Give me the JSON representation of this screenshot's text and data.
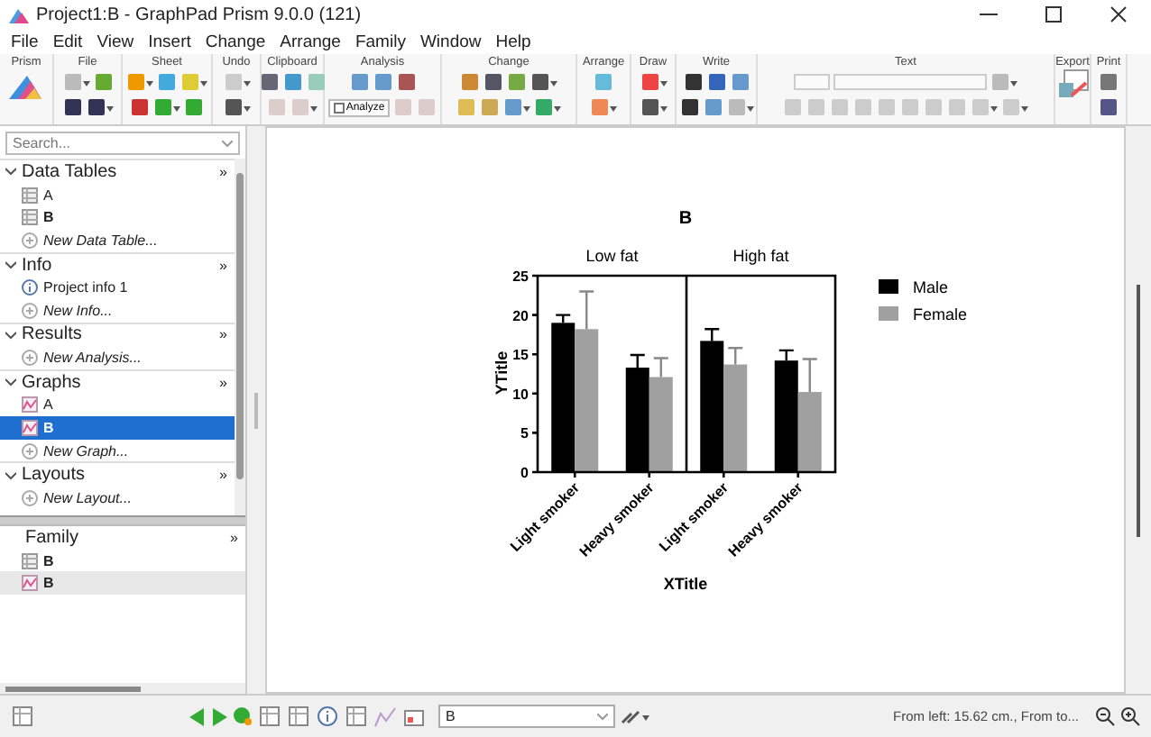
{
  "window": {
    "title": "Project1:B - GraphPad Prism 9.0.0 (121)"
  },
  "menu": [
    "File",
    "Edit",
    "View",
    "Insert",
    "Change",
    "Arrange",
    "Family",
    "Window",
    "Help"
  ],
  "toolbar": {
    "groups": [
      "Prism",
      "File",
      "Sheet",
      "Undo",
      "Clipboard",
      "Analysis",
      "Change",
      "Arrange",
      "Draw",
      "Write",
      "Text",
      "Export",
      "Print"
    ],
    "analyze_button": "Analyze"
  },
  "sidebar": {
    "search": {
      "placeholder": "Search..."
    },
    "sections": [
      {
        "title": "Data Tables",
        "more": "»",
        "expanded": true,
        "items": [
          {
            "kind": "table",
            "label": "A",
            "bold": false,
            "selected": false
          },
          {
            "kind": "table",
            "label": "B",
            "bold": true,
            "selected": false
          },
          {
            "kind": "new",
            "label": "New Data Table...",
            "bold": false,
            "selected": false
          }
        ]
      },
      {
        "title": "Info",
        "more": "»",
        "expanded": true,
        "items": [
          {
            "kind": "info",
            "label": "Project info 1",
            "bold": false,
            "selected": false
          },
          {
            "kind": "new",
            "label": "New Info...",
            "bold": false,
            "selected": false
          }
        ]
      },
      {
        "title": "Results",
        "more": "»",
        "expanded": true,
        "items": [
          {
            "kind": "new",
            "label": "New Analysis...",
            "bold": false,
            "selected": false
          }
        ]
      },
      {
        "title": "Graphs",
        "more": "»",
        "expanded": true,
        "items": [
          {
            "kind": "graph",
            "label": "A",
            "bold": false,
            "selected": false
          },
          {
            "kind": "graph",
            "label": "B",
            "bold": true,
            "selected": true
          },
          {
            "kind": "new",
            "label": "New Graph...",
            "bold": false,
            "selected": false
          }
        ]
      },
      {
        "title": "Layouts",
        "more": "»",
        "expanded": true,
        "items": [
          {
            "kind": "new",
            "label": "New Layout...",
            "bold": false,
            "selected": false
          }
        ]
      }
    ]
  },
  "family": {
    "title": "Family",
    "more": "»",
    "items": [
      {
        "kind": "table",
        "label": "B",
        "bold": true,
        "selected": false
      },
      {
        "kind": "graph",
        "label": "B",
        "bold": true,
        "selected": true
      }
    ]
  },
  "graph": {
    "chart_data": {
      "type": "bar",
      "title": "B",
      "xlabel": "XTitle",
      "ylabel": "YTitle",
      "categories": [
        "Light smoker",
        "Heavy smoker",
        "Light smoker",
        "Heavy smoker"
      ],
      "series": [
        {
          "name": "Male",
          "color": "#000000",
          "values": [
            19,
            13.3,
            16.7,
            14.2
          ]
        },
        {
          "name": "Female",
          "color": "#a0a0a0",
          "values": [
            18.2,
            12.1,
            13.7,
            10.2
          ]
        }
      ],
      "ylim": [
        0,
        25
      ],
      "yticks": [
        0,
        5,
        10,
        15,
        20,
        25
      ],
      "legend": true,
      "annotations": [
        "Low fat",
        "High fat"
      ]
    }
  },
  "status_bar": {
    "sheet_select": "B",
    "position": "From left: 15.62 cm., From to..."
  }
}
